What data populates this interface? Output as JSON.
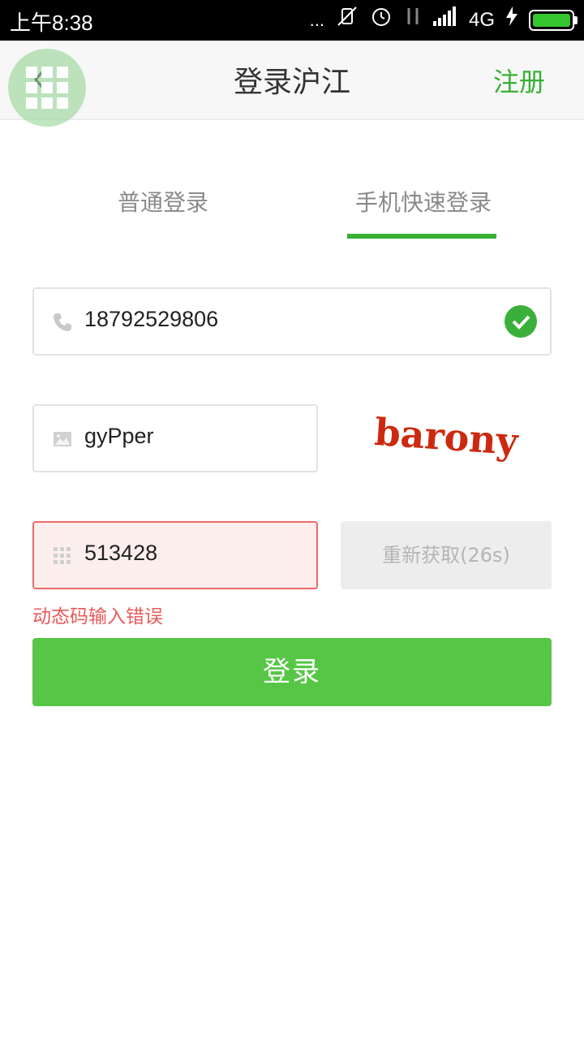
{
  "status_bar": {
    "time": "上午8:38",
    "dots": "...",
    "network": "4G",
    "battery_level": 1.0
  },
  "header": {
    "title": "登录沪江",
    "register_label": "注册"
  },
  "tabs": [
    {
      "label": "普通登录",
      "active": false
    },
    {
      "label": "手机快速登录",
      "active": true
    }
  ],
  "form": {
    "phone_value": "18792529806",
    "captcha_value": "gyPper",
    "captcha_image_text": "barony",
    "code_value": "513428",
    "resend_label": "重新获取(26s)",
    "error_text": "动态码输入错误",
    "login_label": "登录"
  },
  "colors": {
    "accent": "#38b034",
    "button": "#57c647",
    "error": "#e95a5a"
  }
}
